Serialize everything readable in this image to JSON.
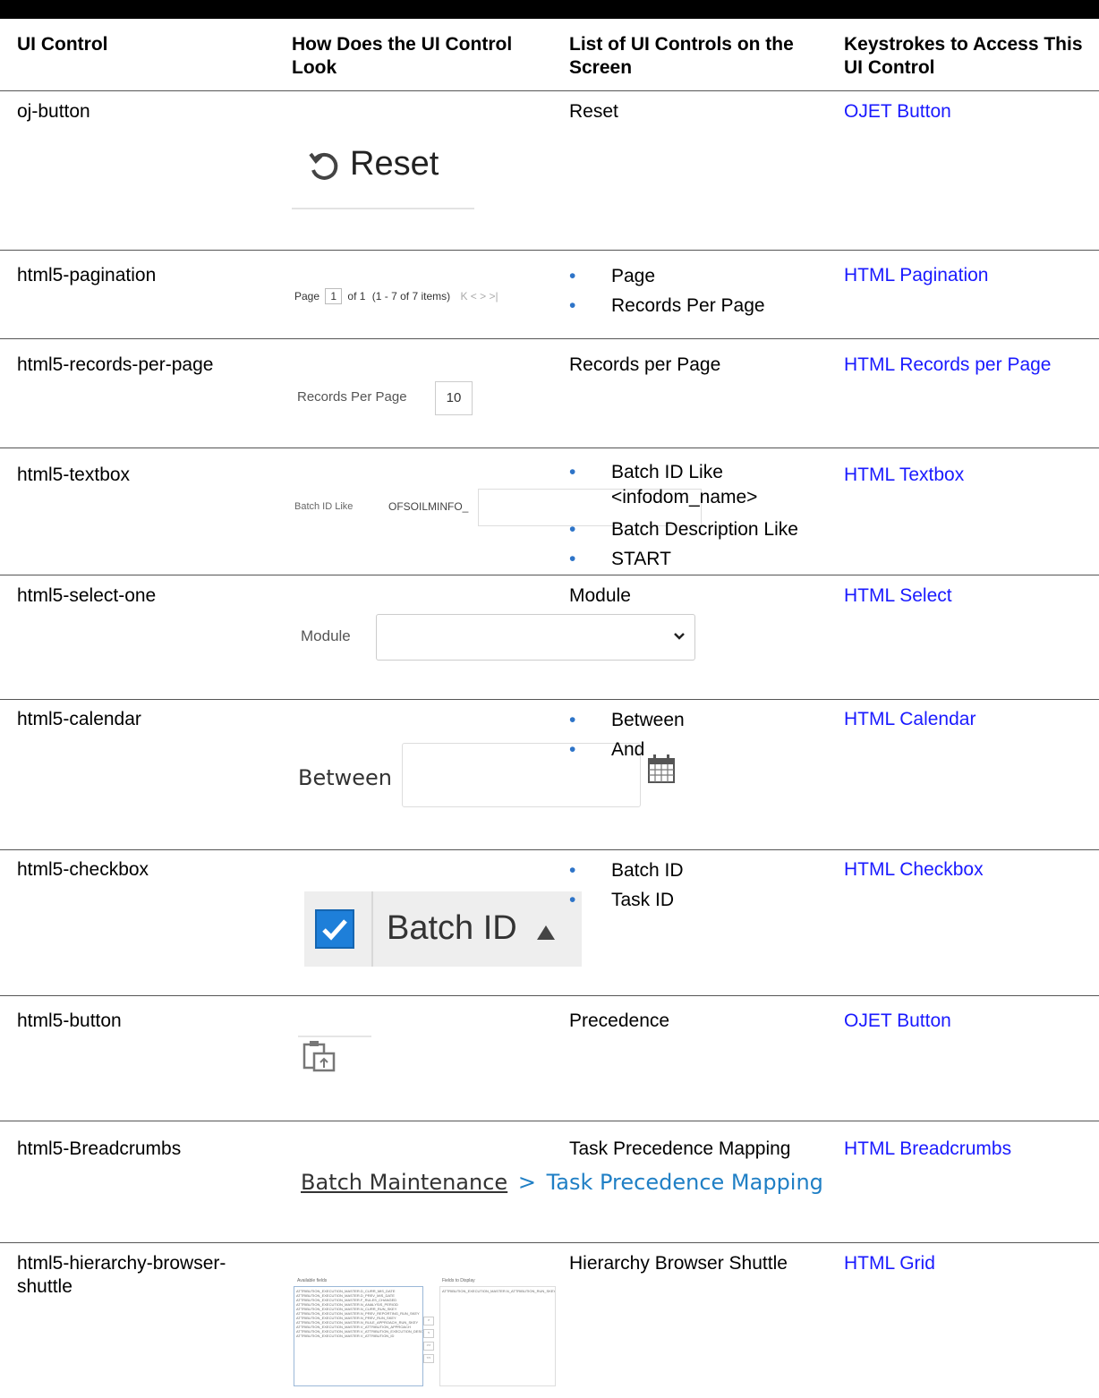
{
  "headers": {
    "col1": "UI Control",
    "col2": "How Does the UI Control Look",
    "col3": "List of UI Controls on the Screen",
    "col4": "Keystrokes to Access This UI Control"
  },
  "rows": [
    {
      "control": "oj-button",
      "list": "Reset",
      "link": "OJET Button",
      "mock": {
        "label": "Reset",
        "icon": "reset-icon"
      }
    },
    {
      "control": "html5-pagination",
      "list_items": [
        "Page",
        "Records Per Page"
      ],
      "link": "HTML Pagination",
      "mock": {
        "page_label": "Page",
        "page_value": "1",
        "of_text": "of 1",
        "items_text": "(1 - 7 of 7 items)",
        "nav_icons": "K < > >|"
      }
    },
    {
      "control": "html5-records-per-page",
      "list": "Records per Page",
      "link": "HTML Records per Page",
      "mock": {
        "label": "Records Per Page",
        "value": "10"
      }
    },
    {
      "control": "html5-textbox",
      "list_items": [
        "Batch ID Like <infodom_name>",
        "Batch Description Like",
        "START"
      ],
      "link": "HTML Textbox",
      "mock": {
        "label": "Batch ID Like",
        "value": "OFSOILMINFO_"
      }
    },
    {
      "control": "html5-select-one",
      "list": "Module",
      "link": "HTML Select",
      "mock": {
        "label": "Module",
        "icon": "chevron-down-icon"
      }
    },
    {
      "control": "html5-calendar",
      "list_items": [
        "Between",
        "And"
      ],
      "link": "HTML Calendar",
      "mock": {
        "label": "Between",
        "icon": "calendar-icon"
      }
    },
    {
      "control": "html5-checkbox",
      "list_items": [
        "Batch ID",
        "Task ID"
      ],
      "link": "HTML Checkbox",
      "mock": {
        "label": "Batch ID",
        "checked": true
      }
    },
    {
      "control": "html5-button",
      "list": "Precedence",
      "link": "OJET Button",
      "mock": {
        "icon": "precedence-icon"
      }
    },
    {
      "control": "html5-Breadcrumbs",
      "list": "Task Precedence Mapping",
      "link": "HTML Breadcrumbs",
      "mock": {
        "crumb1": "Batch Maintenance",
        "separator": ">",
        "crumb2": "Task Precedence Mapping"
      }
    },
    {
      "control": "html5-hierarchy-browser-shuttle",
      "list": "Hierarchy Browser Shuttle",
      "link": "HTML Grid",
      "mock": {
        "available_label": "Available fields",
        "display_label": "Fields to Display",
        "available_items": [
          "ATTRIBUTION_EXECUTION_MASTER.D_CURR_MIS_DATE",
          "ATTRIBUTION_EXECUTION_MASTER.D_PREV_MIS_DATE",
          "ATTRIBUTION_EXECUTION_MASTER.F_RULES_CHANGED",
          "ATTRIBUTION_EXECUTION_MASTER.N_ANALYSIS_PERIOD",
          "ATTRIBUTION_EXECUTION_MASTER.N_CURR_RUN_SKEY",
          "ATTRIBUTION_EXECUTION_MASTER.N_PREV_REPORTING_RUN_SKEY",
          "ATTRIBUTION_EXECUTION_MASTER.N_PREV_RUN_SKEY",
          "ATTRIBUTION_EXECUTION_MASTER.N_RULE_APPROACH_RUN_SKEY",
          "ATTRIBUTION_EXECUTION_MASTER.V_ATTRIBUTION_APPROACH",
          "ATTRIBUTION_EXECUTION_MASTER.V_ATTRIBUTION_EXECUTION_DESC",
          "ATTRIBUTION_EXECUTION_MASTER.V_ATTRIBUTION_ID"
        ],
        "display_items": [
          "ATTRIBUTION_EXECUTION_MASTER.N_ATTRIBUTION_RUN_SKEY"
        ],
        "buttons": [
          ">",
          "<",
          ">>",
          "<<"
        ]
      }
    }
  ]
}
